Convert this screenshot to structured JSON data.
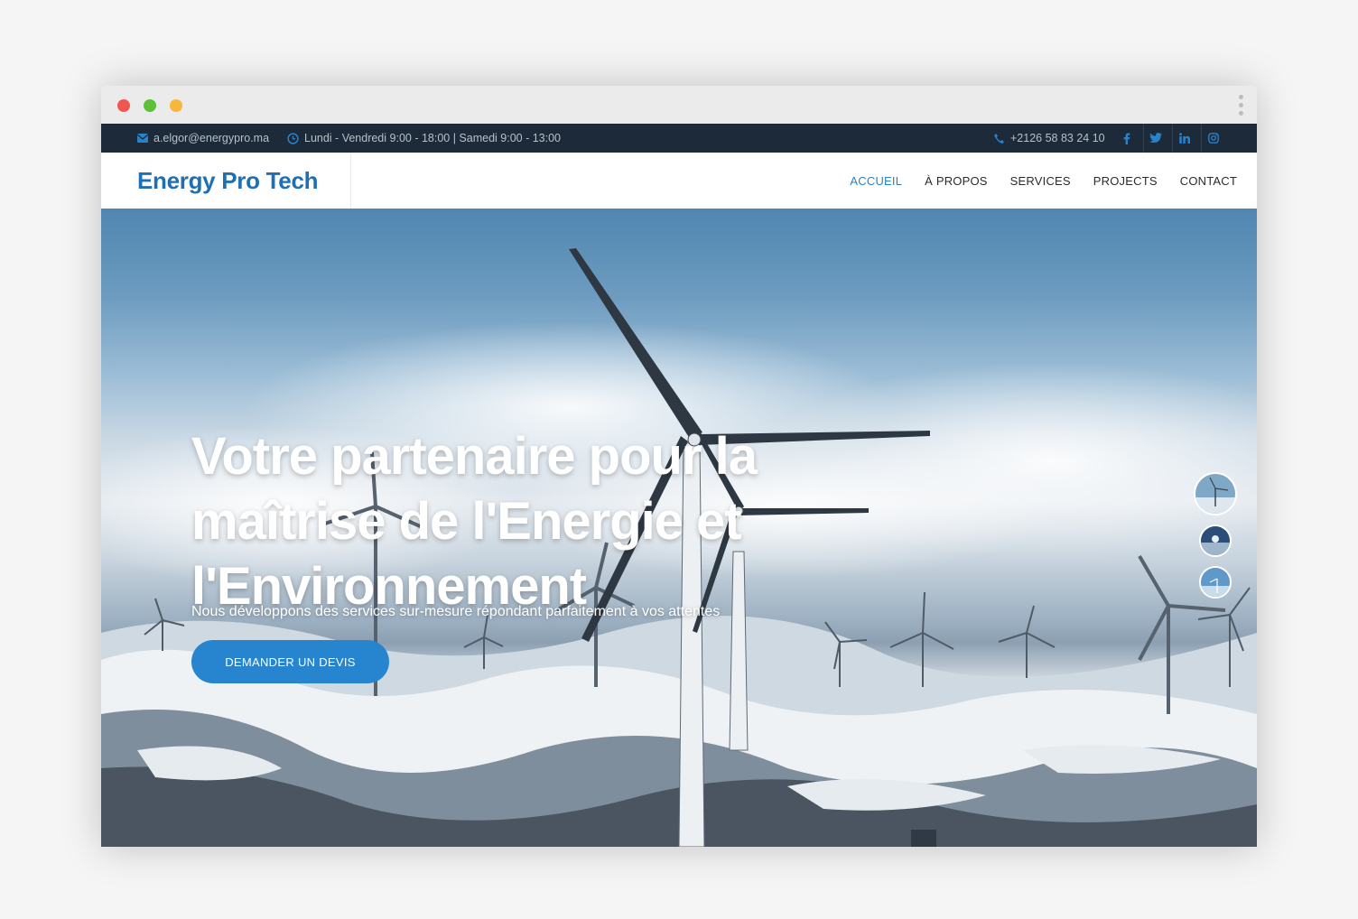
{
  "topbar": {
    "email": "a.elgor@energypro.ma",
    "hours": "Lundi - Vendredi 9:00 - 18:00 | Samedi 9:00 - 13:00",
    "phone": "+2126 58 83 24 10",
    "socials": [
      "facebook-icon",
      "twitter-icon",
      "linkedin-icon",
      "instagram-icon"
    ]
  },
  "navbar": {
    "brand": "Energy Pro Tech",
    "menu": [
      {
        "label": "ACCUEIL",
        "active": true
      },
      {
        "label": "À PROPOS",
        "active": false
      },
      {
        "label": "SERVICES",
        "active": false
      },
      {
        "label": "PROJECTS",
        "active": false
      },
      {
        "label": "CONTACT",
        "active": false
      }
    ]
  },
  "hero": {
    "title": "Votre partenaire pour la maîtrise de l'Energie et l'Environnement",
    "subtitle": "Nous développons des services sur-mesure répondant parfaitement à vos attentes",
    "cta_label": "DEMANDER UN DEVIS"
  },
  "colors": {
    "accent": "#2a82c9",
    "brand": "#1f6fb5",
    "topbar_bg": "#1c2a39",
    "cta_bg": "#2784cf"
  }
}
